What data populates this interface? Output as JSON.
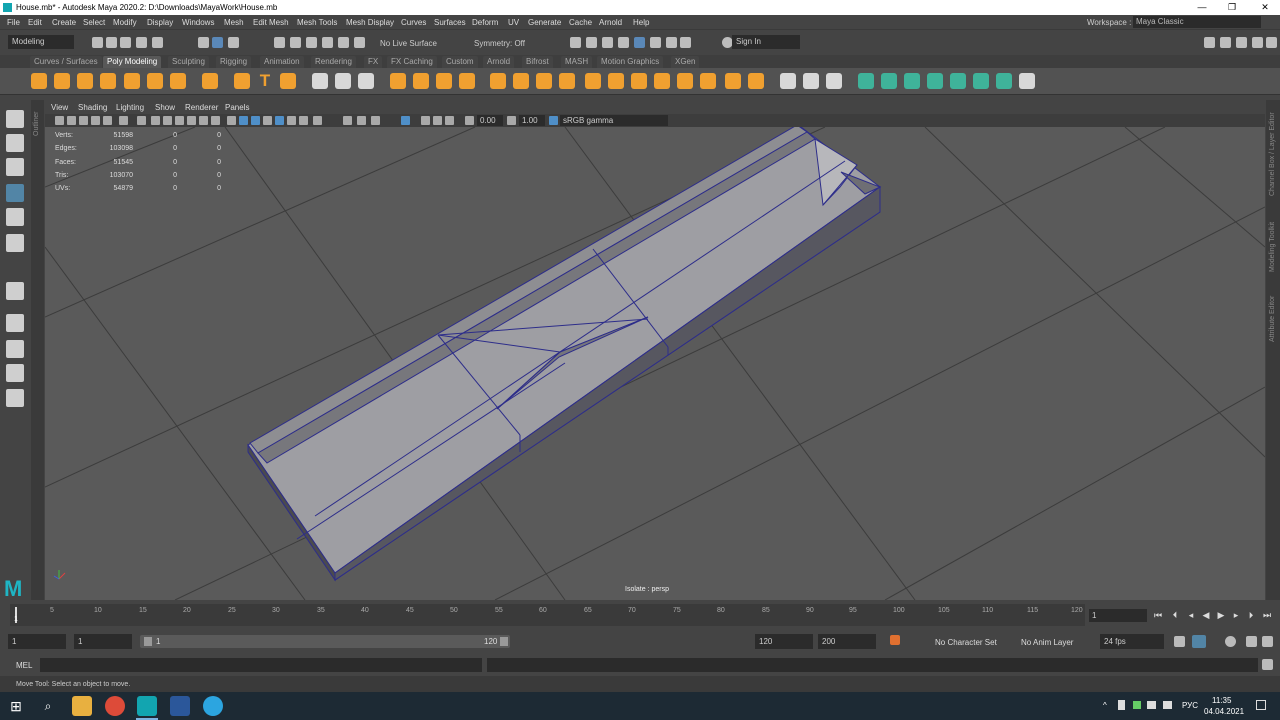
{
  "window": {
    "title": "House.mb* - Autodesk Maya 2020.2: D:\\Downloads\\MayaWork\\House.mb",
    "minimize": "—",
    "maximize": "❐",
    "close": "✕"
  },
  "menu": [
    "File",
    "Edit",
    "Create",
    "Select",
    "Modify",
    "Display",
    "Windows",
    "Mesh",
    "Edit Mesh",
    "Mesh Tools",
    "Mesh Display",
    "Curves",
    "Surfaces",
    "Deform",
    "UV",
    "Generate",
    "Cache",
    "Arnold",
    "Help"
  ],
  "workspace": {
    "label": "Workspace :",
    "value": "Maya Classic"
  },
  "status": {
    "mode": "Modeling",
    "live_surface": "No Live Surface",
    "symmetry": "Symmetry: Off",
    "sign_in": "Sign In"
  },
  "shelf_tabs": [
    "Curves / Surfaces",
    "Poly Modeling",
    "Sculpting",
    "Rigging",
    "Animation",
    "Rendering",
    "FX",
    "FX Caching",
    "Custom",
    "Arnold",
    "Bifrost",
    "MASH",
    "Motion Graphics",
    "XGen"
  ],
  "active_shelf": "Poly Modeling",
  "panel_menu": [
    "View",
    "Shading",
    "Lighting",
    "Show",
    "Renderer",
    "Panels"
  ],
  "panel_toolbar": {
    "exposure": "0.00",
    "gamma": "1.00",
    "colorspace": "sRGB gamma"
  },
  "hud": [
    {
      "label": "Verts:",
      "a": "51598",
      "b": "0",
      "c": "0"
    },
    {
      "label": "Edges:",
      "a": "103098",
      "b": "0",
      "c": "0"
    },
    {
      "label": "Faces:",
      "a": "51545",
      "b": "0",
      "c": "0"
    },
    {
      "label": "Tris:",
      "a": "103070",
      "b": "0",
      "c": "0"
    },
    {
      "label": "UVs:",
      "a": "54879",
      "b": "0",
      "c": "0"
    }
  ],
  "viewport": {
    "camera_label": "Isolate : persp"
  },
  "side_panels": {
    "outliner": "Outliner",
    "channel_box": "Channel Box / Layer Editor",
    "modeling_toolkit": "Modeling Toolkit",
    "attribute_editor": "Attribute Editor"
  },
  "timeline": {
    "ticks": [
      "5",
      "10",
      "15",
      "20",
      "25",
      "30",
      "35",
      "40",
      "45",
      "50",
      "55",
      "60",
      "65",
      "70",
      "75",
      "80",
      "85",
      "90",
      "95",
      "100",
      "105",
      "110",
      "115",
      "120"
    ],
    "start_marker": "1",
    "current_frame": "1"
  },
  "range": {
    "start": "1",
    "anim_start": "1",
    "slider_start": "1",
    "slider_end": "120",
    "anim_end": "120",
    "end": "200",
    "character_set": "No Character Set",
    "anim_layer": "No Anim Layer",
    "fps": "24 fps"
  },
  "command": {
    "lang": "MEL"
  },
  "help_line": "Move Tool: Select an object to move.",
  "taskbar": {
    "lang": "РУС",
    "time": "11:35",
    "date": "04.04.2021"
  },
  "colors": {
    "viewport_bg": "#5a5a5a",
    "mesh_fill": "#a9a9ad",
    "wire": "#2d2d8a",
    "shelf_orange": "#f0a030"
  }
}
